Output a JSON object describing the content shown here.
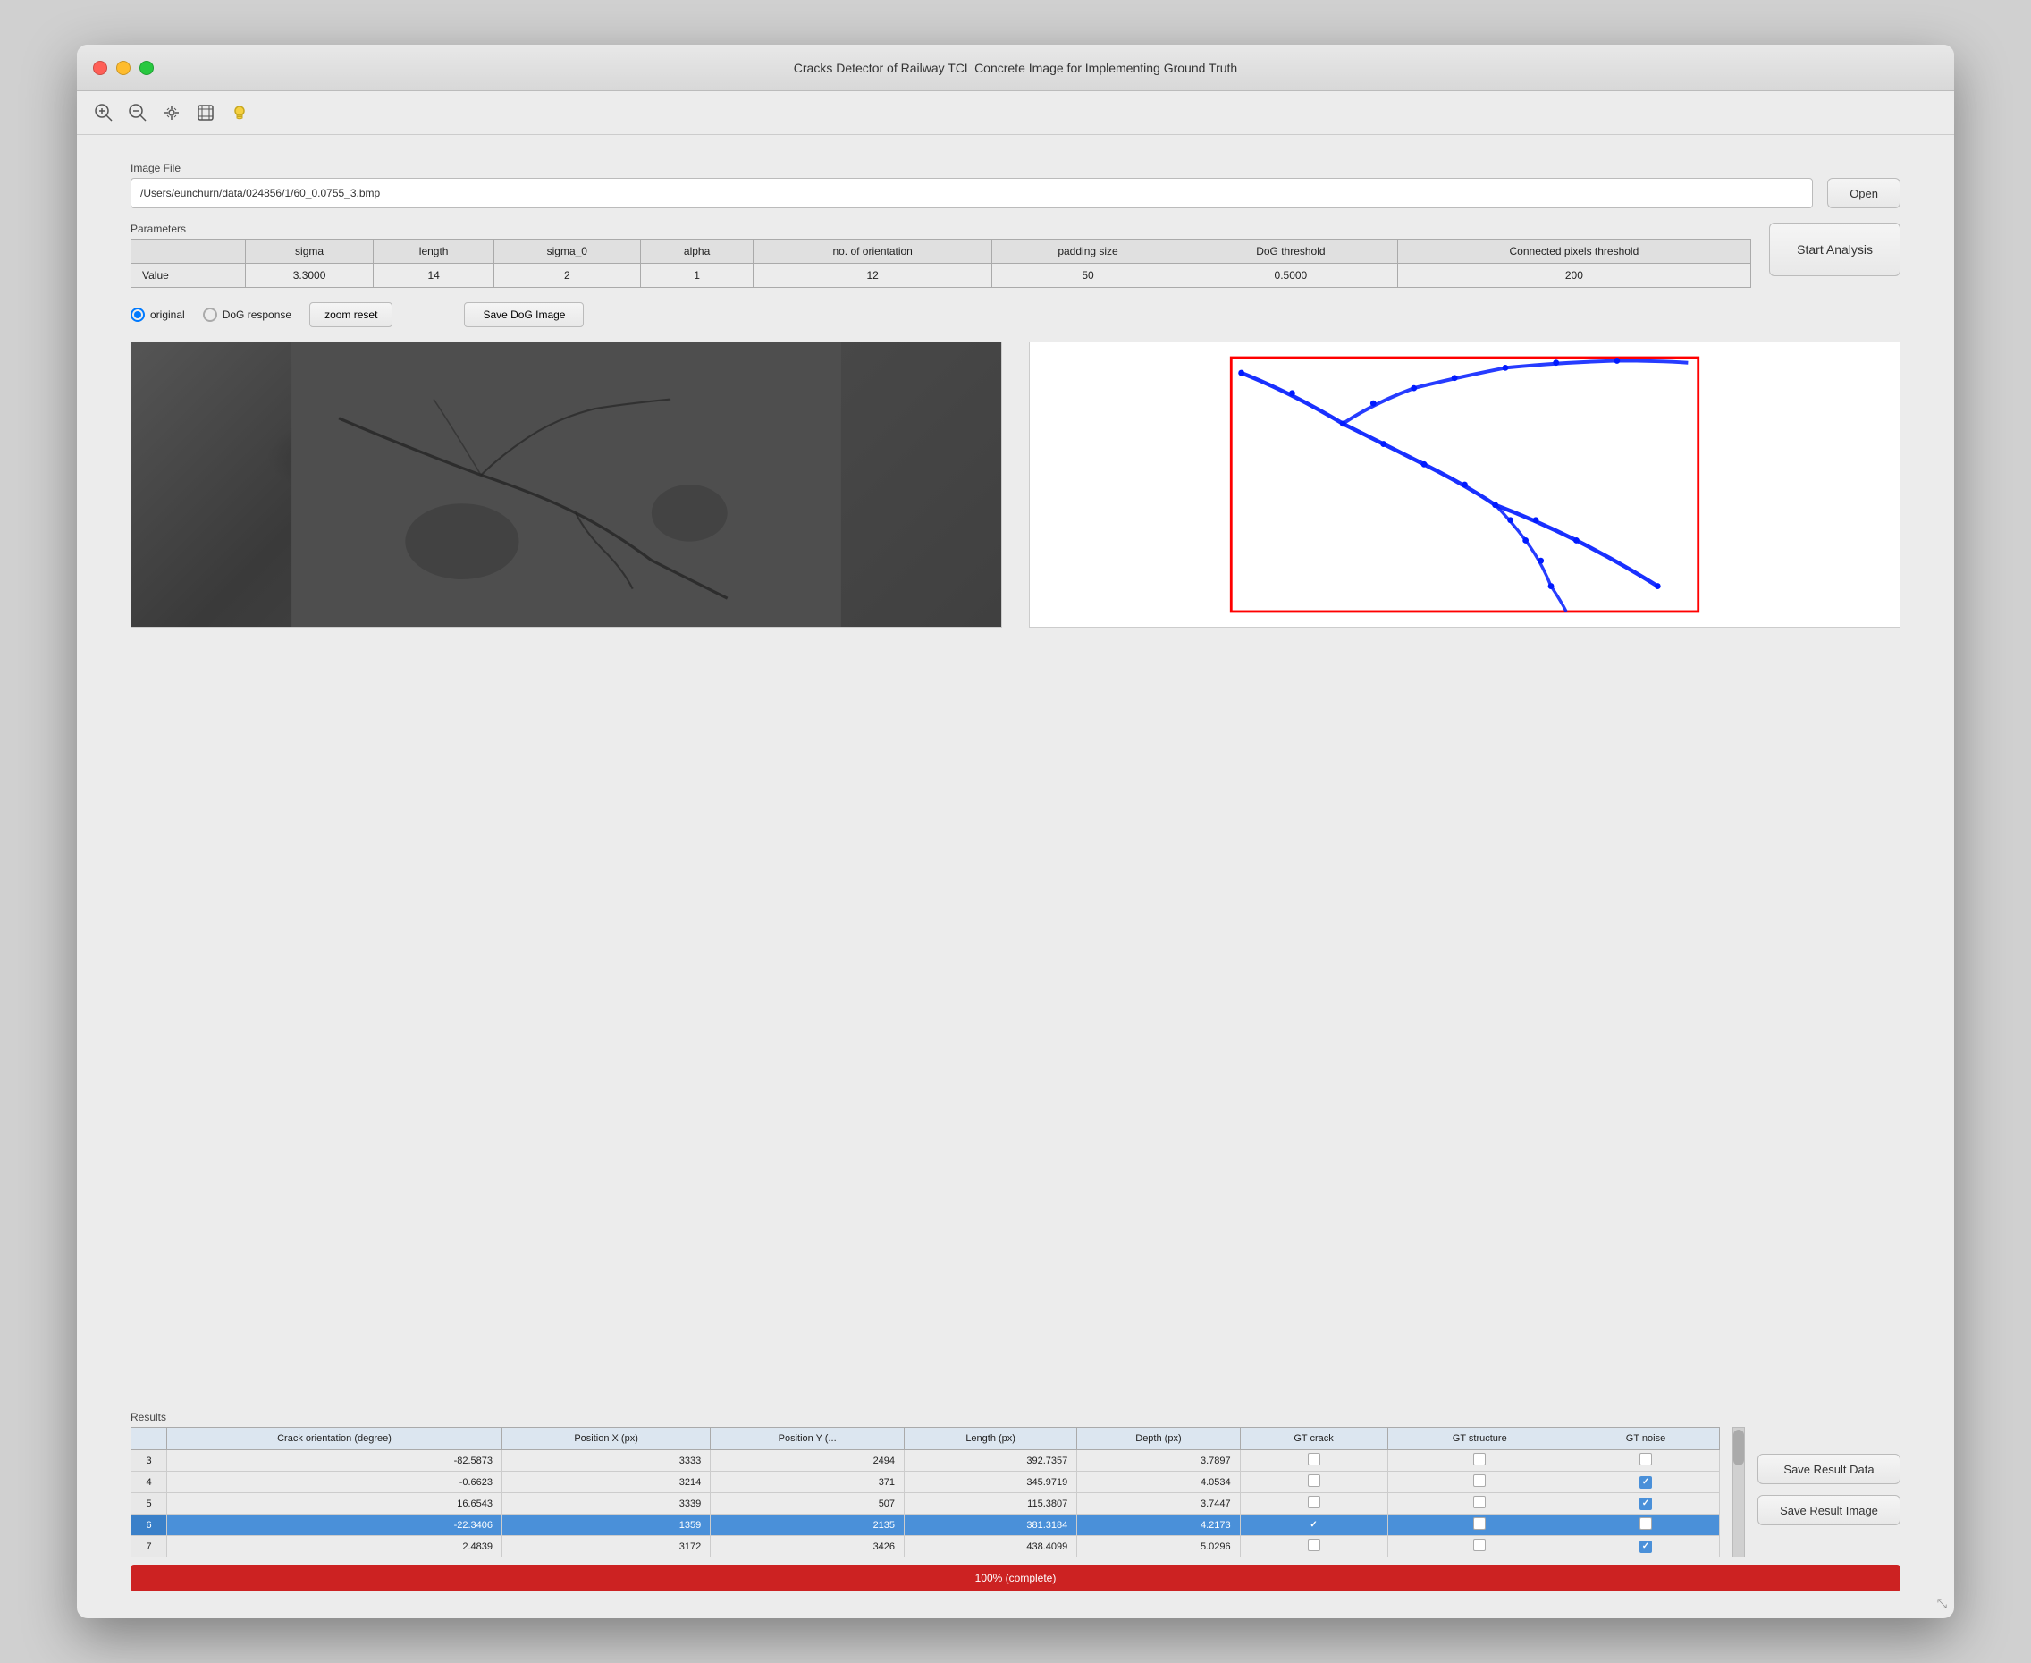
{
  "window": {
    "title": "Cracks Detector of Railway TCL Concrete Image for Implementing Ground Truth"
  },
  "toolbar": {
    "icons": [
      "zoom-in",
      "zoom-out",
      "pan",
      "cursor",
      "bulb"
    ]
  },
  "file": {
    "label": "Image File",
    "path": "/Users/eunchurn/data/024856/1/60_0.0755_3.bmp",
    "open_button": "Open"
  },
  "params": {
    "label": "Parameters",
    "headers": [
      "",
      "sigma",
      "length",
      "sigma_0",
      "alpha",
      "no. of orientation",
      "padding size",
      "DoG threshold",
      "Connected pixels threshold"
    ],
    "row_label": "Value",
    "values": [
      "3.3000",
      "14",
      "2",
      "1",
      "12",
      "50",
      "0.5000",
      "200"
    ]
  },
  "controls": {
    "radio_original": "original",
    "radio_dog": "DoG response",
    "zoom_reset": "zoom reset",
    "save_dog": "Save DoG Image",
    "start_analysis": "Start Analysis"
  },
  "results": {
    "label": "Results",
    "headers": [
      "Crack orientation (degree)",
      "Position X (px)",
      "Position Y (...",
      "Length (px)",
      "Depth (px)",
      "GT crack",
      "GT structure",
      "GT noise"
    ],
    "rows": [
      {
        "id": "3",
        "crack_orientation": "-82.5873",
        "pos_x": "3333",
        "pos_y": "2494",
        "length": "392.7357",
        "depth": "3.7897",
        "gt_crack": false,
        "gt_structure": false,
        "gt_noise": false,
        "selected": false
      },
      {
        "id": "4",
        "crack_orientation": "-0.6623",
        "pos_x": "3214",
        "pos_y": "371",
        "length": "345.9719",
        "depth": "4.0534",
        "gt_crack": false,
        "gt_structure": false,
        "gt_noise": true,
        "selected": false
      },
      {
        "id": "5",
        "crack_orientation": "16.6543",
        "pos_x": "3339",
        "pos_y": "507",
        "length": "115.3807",
        "depth": "3.7447",
        "gt_crack": false,
        "gt_structure": false,
        "gt_noise": true,
        "selected": false
      },
      {
        "id": "6",
        "crack_orientation": "-22.3406",
        "pos_x": "1359",
        "pos_y": "2135",
        "length": "381.3184",
        "depth": "4.2173",
        "gt_crack": true,
        "gt_structure": false,
        "gt_noise": false,
        "selected": true
      },
      {
        "id": "7",
        "crack_orientation": "2.4839",
        "pos_x": "3172",
        "pos_y": "3426",
        "length": "438.4099",
        "depth": "5.0296",
        "gt_crack": false,
        "gt_structure": false,
        "gt_noise": true,
        "selected": false
      }
    ],
    "save_result_data": "Save Result Data",
    "save_result_image": "Save Result Image"
  },
  "progress": {
    "text": "100% (complete)",
    "value": 100
  }
}
